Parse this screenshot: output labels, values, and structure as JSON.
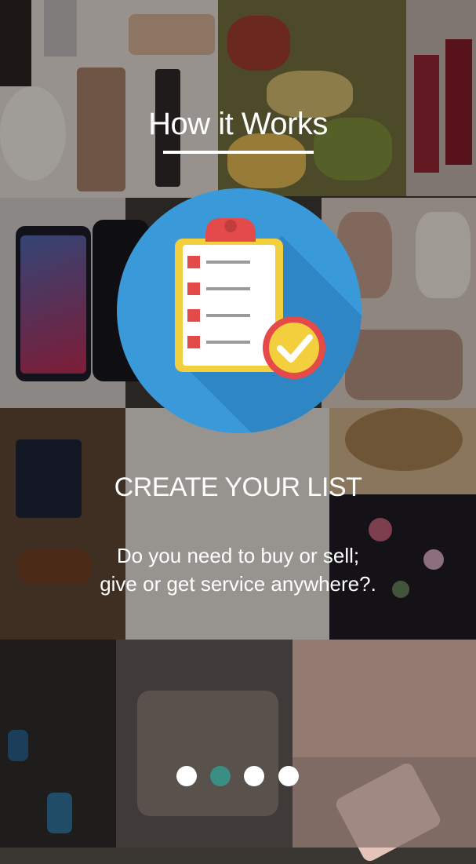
{
  "onboarding": {
    "title": "How it Works",
    "step_heading": "CREATE YOUR LIST",
    "description_line1": "Do you need to buy or sell;",
    "description_line2": "give or get service anywhere?."
  },
  "pager": {
    "total": 4,
    "active_index": 1,
    "active_color": "#3b8e84",
    "inactive_color": "#ffffff"
  },
  "illustration": {
    "icon": "checklist-icon",
    "circle_color": "#3a9ad9",
    "clipboard_color": "#f3cf3d",
    "clip_color": "#e44a4a",
    "check_badge_color": "#f3cf3d"
  },
  "background": {
    "description_icon": "product-collage"
  }
}
